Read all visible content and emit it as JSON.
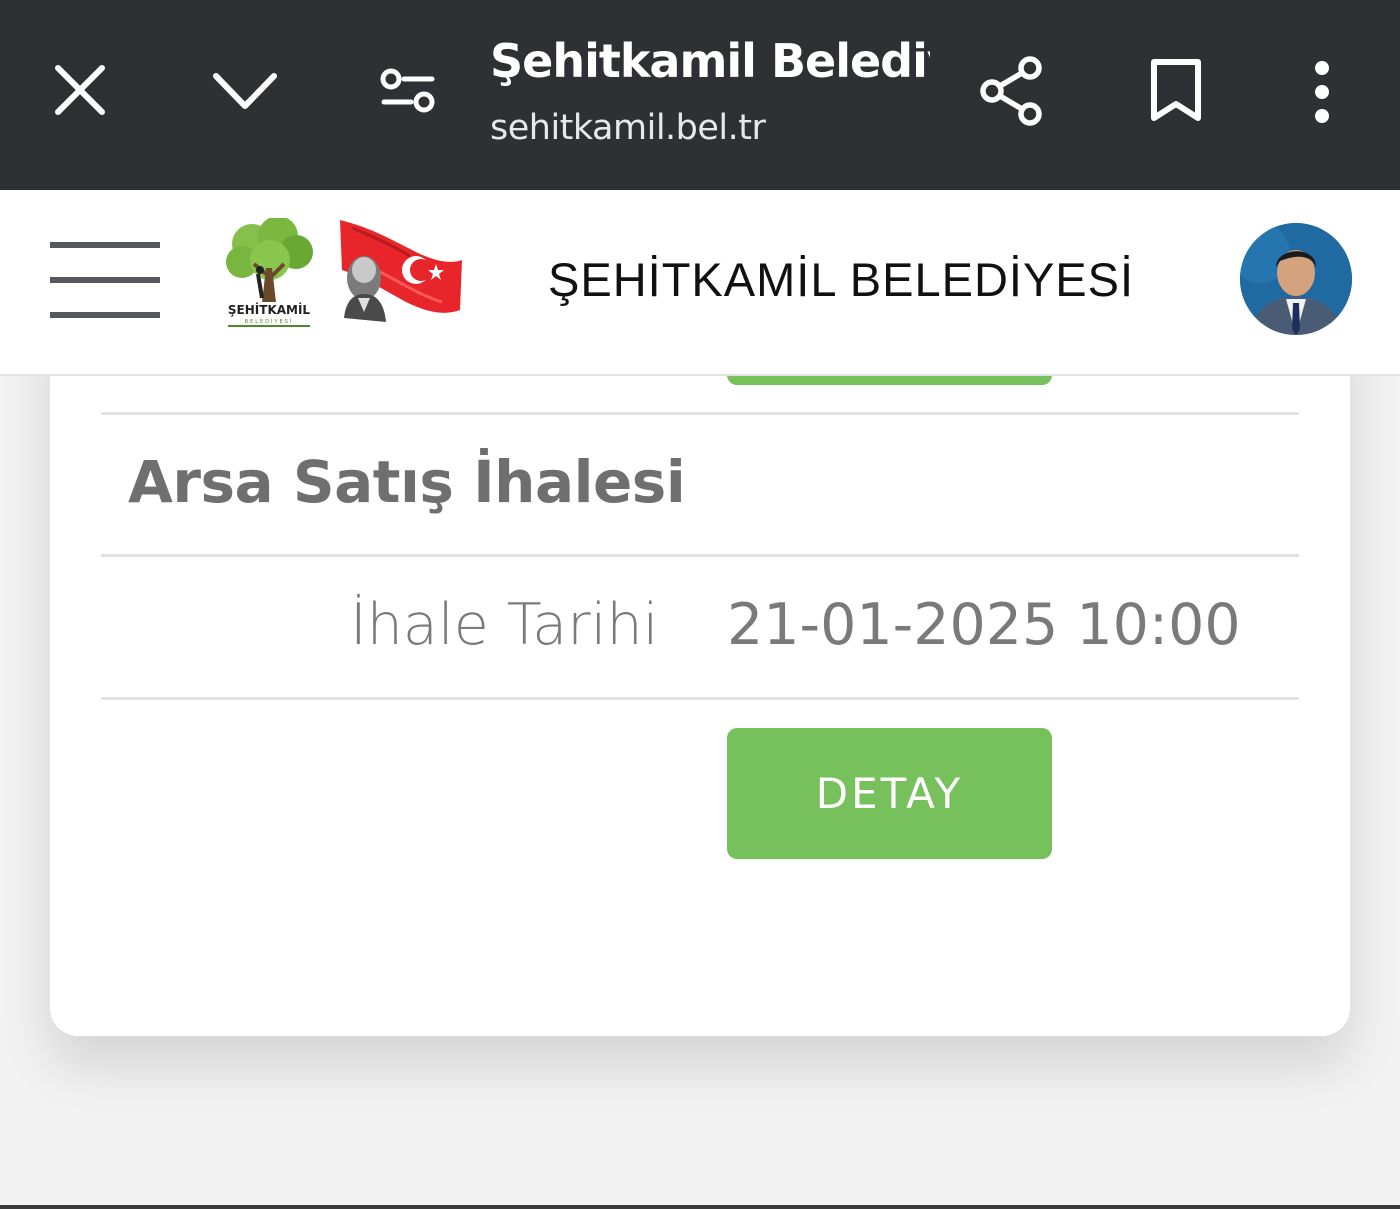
{
  "browser": {
    "page_title": "Şehitkamil Belediy...",
    "url": "sehitkamil.bel.tr",
    "icons": [
      "close-icon",
      "chevron-down-icon",
      "site-settings-icon",
      "share-icon",
      "bookmark-icon",
      "more-vert-icon"
    ]
  },
  "header": {
    "title": "ŞEHİTKAMİL BELEDİYESİ",
    "logo_text": "ŞEHİTKAMİL",
    "logo_subtext": "BELEDİYESİ"
  },
  "card": {
    "title": "Arsa Satış İhalesi",
    "date_label": "İhale Tarihi",
    "date_value": "21-01-2025 10:00",
    "button_label": "DETAY"
  },
  "colors": {
    "chrome_bg": "#2f3034",
    "accent_green": "#76c15b",
    "text_gray": "#7a7a7a",
    "page_bg": "#f2f2f2"
  }
}
